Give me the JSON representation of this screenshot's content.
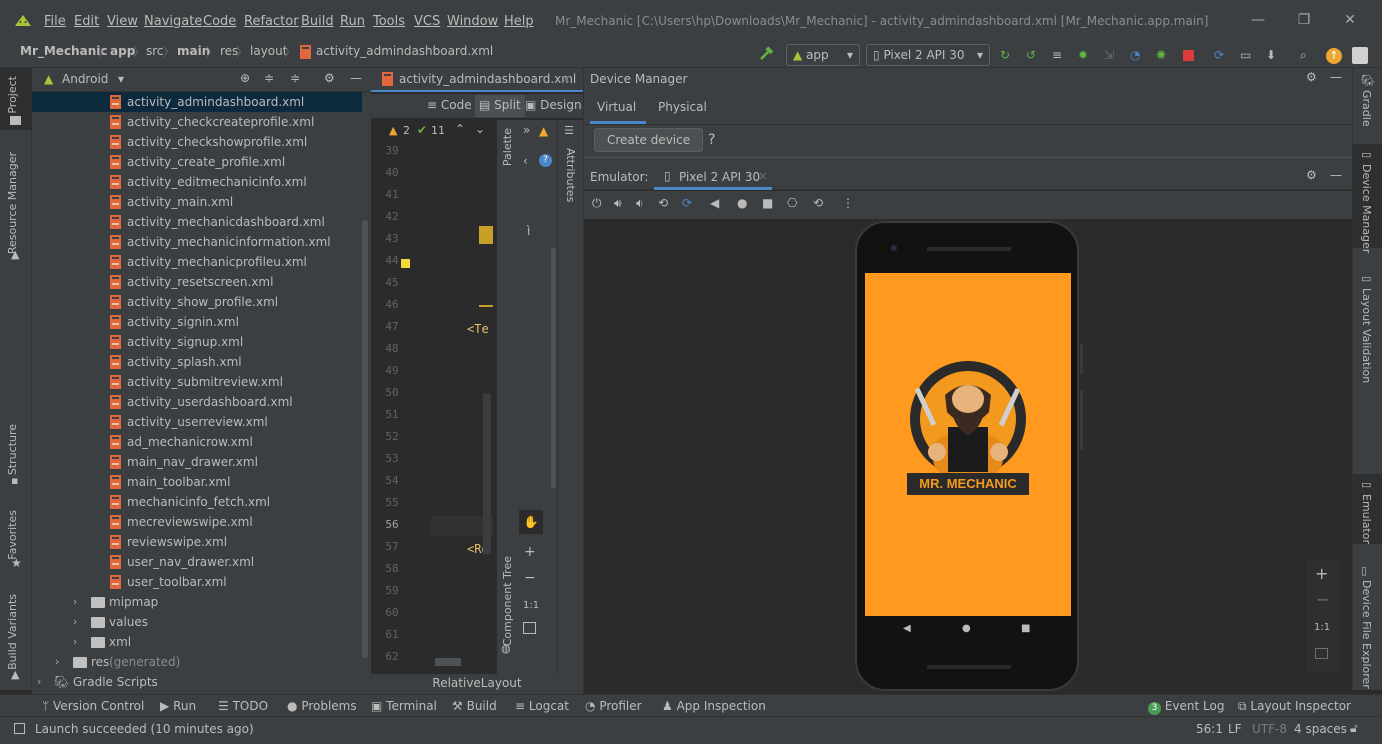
{
  "menu": {
    "items": [
      "File",
      "Edit",
      "View",
      "Navigate",
      "Code",
      "Refactor",
      "Build",
      "Run",
      "Tools",
      "VCS",
      "Window",
      "Help"
    ],
    "title": "Mr_Mechanic [C:\\Users\\hp\\Downloads\\Mr_Mechanic] - activity_admindashboard.xml [Mr_Mechanic.app.main]"
  },
  "nav": {
    "crumbs": [
      "Mr_Mechanic",
      "app",
      "src",
      "main",
      "res",
      "layout",
      "activity_admindashboard.xml"
    ],
    "run_config": "app",
    "device": "Pixel 2 API 30"
  },
  "left_stripe": [
    "Project",
    "Resource Manager",
    "Structure",
    "Favorites",
    "Build Variants"
  ],
  "right_stripe": [
    "Gradle",
    "Device Manager",
    "Layout Validation",
    "Emulator",
    "Device File Explorer"
  ],
  "project": {
    "view": "Android",
    "files": [
      "activity_admindashboard.xml",
      "activity_checkcreateprofile.xml",
      "activity_checkshowprofile.xml",
      "activity_create_profile.xml",
      "activity_editmechanicinfo.xml",
      "activity_main.xml",
      "activity_mechanicdashboard.xml",
      "activity_mechanicinformation.xml",
      "activity_mechanicprofileu.xml",
      "activity_resetscreen.xml",
      "activity_show_profile.xml",
      "activity_signin.xml",
      "activity_signup.xml",
      "activity_splash.xml",
      "activity_submitreview.xml",
      "activity_userdashboard.xml",
      "activity_userreview.xml",
      "ad_mechanicrow.xml",
      "main_nav_drawer.xml",
      "main_toolbar.xml",
      "mechanicinfo_fetch.xml",
      "mecreviewswipe.xml",
      "reviewswipe.xml",
      "user_nav_drawer.xml",
      "user_toolbar.xml"
    ],
    "folders": [
      "mipmap",
      "values",
      "xml"
    ],
    "res_generated": "res",
    "res_generated_suffix": "(generated)",
    "gradle": "Gradle Scripts"
  },
  "editor": {
    "tab": "activity_admindashboard.xml",
    "modes": [
      "Code",
      "Split",
      "Design"
    ],
    "warnings": "2",
    "checks": "11",
    "lines": [
      "39",
      "40",
      "41",
      "42",
      "43",
      "44",
      "45",
      "46",
      "47",
      "48",
      "49",
      "50",
      "51",
      "52",
      "53",
      "54",
      "55",
      "56",
      "57",
      "58",
      "59",
      "60",
      "61",
      "62"
    ],
    "code_tex": "<Te",
    "code_re": "<Re",
    "palette": "Palette",
    "attributes": "Attributes",
    "component_tree": "Component Tree",
    "zoom_label": "1:1",
    "footer": "RelativeLayout"
  },
  "device_manager": {
    "title": "Device Manager",
    "tabs": [
      "Virtual",
      "Physical"
    ],
    "create_button": "Create device",
    "help": "?"
  },
  "emulator": {
    "label": "Emulator:",
    "tab": "Pixel 2 API 30",
    "app_logo_text": "MR. MECHANIC",
    "zoom_label": "1:1"
  },
  "bottom": {
    "tools": [
      "Version Control",
      "Run",
      "TODO",
      "Problems",
      "Terminal",
      "Build",
      "Logcat",
      "Profiler",
      "App Inspection"
    ],
    "event_log": "Event Log",
    "event_count": "3",
    "layout_inspector": "Layout Inspector"
  },
  "status": {
    "message": "Launch succeeded (10 minutes ago)",
    "position": "56:1",
    "line_sep": "LF",
    "encoding": "UTF-8",
    "indent": "4 spaces"
  },
  "colors": {
    "accent": "#4a88c7",
    "app_bg": "#ff9a1f",
    "android_green": "#a4c639",
    "xml_icon": "#e0673e"
  }
}
